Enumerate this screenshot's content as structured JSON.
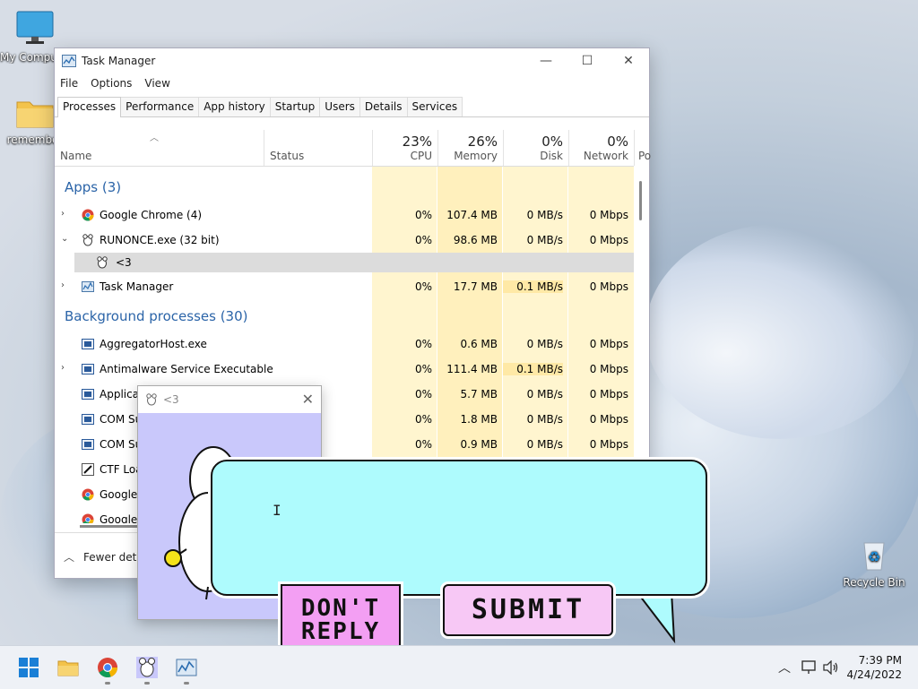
{
  "desktop": {
    "icons": [
      {
        "label": "My Computer",
        "icon": "monitor-icon"
      },
      {
        "label": "remember",
        "icon": "folder-icon"
      },
      {
        "label": "Recycle Bin",
        "icon": "recycle-bin-icon"
      }
    ]
  },
  "task_manager": {
    "title": "Task Manager",
    "menu": [
      "File",
      "Options",
      "View"
    ],
    "tabs": [
      "Processes",
      "Performance",
      "App history",
      "Startup",
      "Users",
      "Details",
      "Services"
    ],
    "active_tab": "Processes",
    "columns": {
      "name": "Name",
      "status": "Status",
      "cpu": {
        "pct": "23%",
        "label": "CPU"
      },
      "memory": {
        "pct": "26%",
        "label": "Memory"
      },
      "disk": {
        "pct": "0%",
        "label": "Disk"
      },
      "network": {
        "pct": "0%",
        "label": "Network"
      },
      "power": "Po"
    },
    "groups": {
      "apps": "Apps (3)",
      "background": "Background processes (30)"
    },
    "apps": [
      {
        "name": "Google Chrome (4)",
        "cpu": "0%",
        "memory": "107.4 MB",
        "disk": "0 MB/s",
        "network": "0 Mbps",
        "expand": "›"
      },
      {
        "name": "RUNONCE.exe (32 bit)",
        "cpu": "0%",
        "memory": "98.6 MB",
        "disk": "0 MB/s",
        "network": "0 Mbps",
        "expand": "⌄"
      },
      {
        "name": "<3",
        "child": true
      },
      {
        "name": "Task Manager",
        "cpu": "0%",
        "memory": "17.7 MB",
        "disk": "0.1 MB/s",
        "network": "0 Mbps",
        "expand": "›"
      }
    ],
    "background": [
      {
        "name": "AggregatorHost.exe",
        "cpu": "0%",
        "memory": "0.6 MB",
        "disk": "0 MB/s",
        "network": "0 Mbps",
        "expand": ""
      },
      {
        "name": "Antimalware Service Executable",
        "cpu": "0%",
        "memory": "111.4 MB",
        "disk": "0.1 MB/s",
        "network": "0 Mbps",
        "expand": "›"
      },
      {
        "name": "Applicat",
        "cpu": "0%",
        "memory": "5.7 MB",
        "disk": "0 MB/s",
        "network": "0 Mbps",
        "expand": ""
      },
      {
        "name": "COM Su",
        "cpu": "0%",
        "memory": "1.8 MB",
        "disk": "0 MB/s",
        "network": "0 Mbps",
        "expand": ""
      },
      {
        "name": "COM Su",
        "cpu": "0%",
        "memory": "0.9 MB",
        "disk": "0 MB/s",
        "network": "0 Mbps",
        "expand": ""
      },
      {
        "name": "CTF Loa",
        "cpu": "",
        "memory": "",
        "disk": "",
        "network": "",
        "expand": ""
      },
      {
        "name": "Google",
        "cpu": "",
        "memory": "",
        "disk": "",
        "network": "",
        "expand": ""
      },
      {
        "name": "Google",
        "cpu": "",
        "memory": "",
        "disk": "",
        "network": "",
        "expand": ""
      }
    ],
    "footer": "Fewer details"
  },
  "heart_window": {
    "title": "<3"
  },
  "popup": {
    "dont_reply": "DON'T REPLY",
    "submit": "SUBMIT"
  },
  "taskbar": {
    "time": "7:39 PM",
    "date": "4/24/2022"
  }
}
